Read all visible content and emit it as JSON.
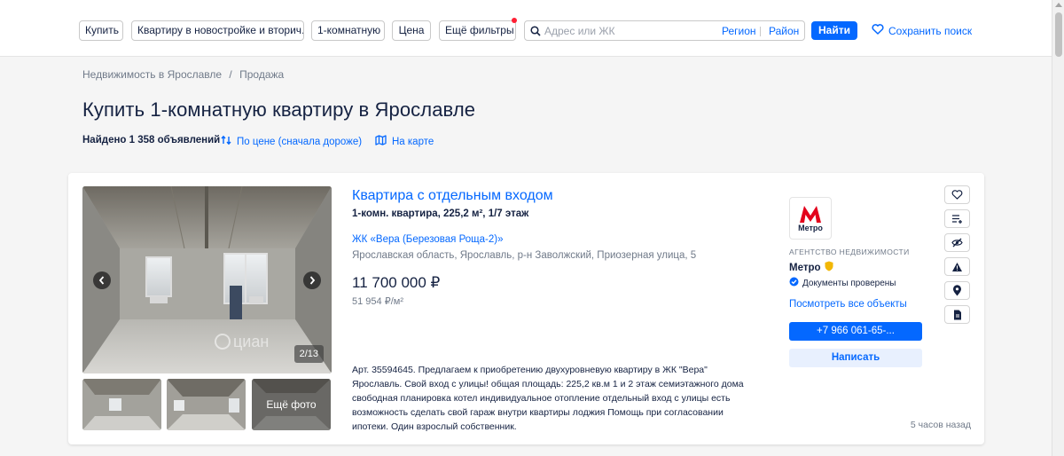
{
  "filters": {
    "buy": "Купить",
    "type": "Квартиру в новостройке и вторич...",
    "rooms": "1-комнатную",
    "price": "Цена",
    "more": "Ещё фильтры",
    "search_placeholder": "Адрес или ЖК",
    "region": "Регион",
    "district": "Район",
    "find": "Найти",
    "save_search": "Сохранить поиск"
  },
  "breadcrumb": {
    "item1": "Недвижимость в Ярославле",
    "separator": "/",
    "item2": "Продажа"
  },
  "page_title": "Купить 1-комнатную квартиру в Ярославле",
  "results": {
    "found": "Найдено 1 358 объявлений",
    "sort": "По цене (сначала дороже)",
    "map": "На карте"
  },
  "listing": {
    "title": "Квартира с отдельным входом",
    "subtitle": "1-комн. квартира, 225,2 м², 1/7 этаж",
    "complex": "ЖК «Вера (Березовая Роща-2)»",
    "address": "Ярославская область, Ярославль, р-н Заволжский, Приозерная улица, 5",
    "price": "11 700 000 ₽",
    "price_per_sqm": "51 954 ₽/м²",
    "photo_counter": "2/13",
    "more_photos": "Ещё фото",
    "watermark": "циан",
    "description": "Арт. 35594645. Предлагаем к приобретению двухуровневую квартиру в ЖК \"Вера\" Ярославль. Свой вход с улицы! общая площадь: 225,2 кв.м 1 и 2 этаж семиэтажного дома свободная планировка котел индивидуальное отопление отдельный вход с улицы есть возможность сделать свой гараж внутри квартиры лоджия Помощь при согласовании ипотеки. Один взрослый собственник.",
    "time_ago": "5 часов назад"
  },
  "agency": {
    "logo_text": "Метро",
    "type": "АГЕНТСТВО НЕДВИЖИМОСТИ",
    "name": "Метро",
    "verified": "Документы проверены",
    "all_objects": "Посмотреть все объекты",
    "phone": "+7 966 061-65-...",
    "write": "Написать"
  },
  "actions": [
    "heart-icon",
    "compare-icon",
    "hide-icon",
    "report-icon",
    "location-icon",
    "document-icon"
  ],
  "colors": {
    "accent": "#0468ff",
    "text": "#152242",
    "muted": "#707a89",
    "badge_dot": "#ff1f34",
    "logo_red": "#e3001b"
  }
}
